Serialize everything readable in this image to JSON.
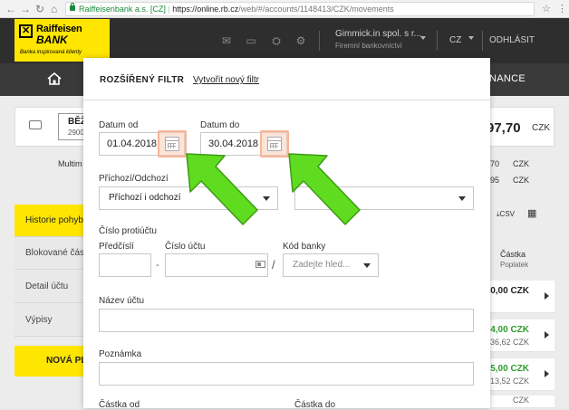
{
  "browser": {
    "secure_label": "Raiffeisenbank a.s. [CZ]",
    "url_host": "https://online.rb.cz",
    "url_path": "/web/#/accounts/1148413/CZK/movements"
  },
  "header": {
    "logo_line1": "Raiffeisen",
    "logo_line2": "BANK",
    "logo_tagline": "Banka inspirovaná klienty",
    "user_name": "Gimmick.in spol. s r...",
    "user_role": "Firemní bankovnictví",
    "currency": "CZ",
    "logout": "ODHLÁSIT"
  },
  "nav": {
    "finance_label": "NANCE"
  },
  "background": {
    "account_name": "BĚŽ",
    "account_number": "2900",
    "balance": "97,70",
    "balance_currency": "CZK",
    "multi_label": "Multim",
    "row1_value": "70",
    "row1_currency": "CZK",
    "row2_value": "95",
    "row2_currency": "CZK",
    "csv_label": "CSV",
    "column_title": "Částka",
    "column_sub": "Poplatek",
    "sidebar": [
      {
        "label": "Historie pohybů"
      },
      {
        "label": "Blokované část"
      },
      {
        "label": "Detail účtu"
      },
      {
        "label": "Výpisy"
      }
    ],
    "new_button": "NOVÁ PL",
    "rows": [
      {
        "value": "0,00 CZK",
        "sub": ""
      },
      {
        "value": "4,00 CZK",
        "sub": "36,62 CZK"
      },
      {
        "value": "5,00 CZK",
        "sub": "13,52 CZK"
      },
      {
        "value": "",
        "sub": "CZK"
      }
    ]
  },
  "modal": {
    "title": "ROZŠÍŘENÝ FILTR",
    "new_filter_link": "Vytvořit nový filtr",
    "date_from_label": "Datum od",
    "date_from_value": "01.04.2018",
    "date_to_label": "Datum do",
    "date_to_value": "30.04.2018",
    "direction_label": "Příchozí/Odchozí",
    "direction_value": "Příchozí i odchozí",
    "counter_account_label": "Číslo protiúčtu",
    "prefix_label": "Předčíslí",
    "account_number_label": "Číslo účtu",
    "bank_code_label": "Kód banky",
    "bank_code_placeholder": "Zadejte hled...",
    "separator_dash": "-",
    "separator_slash": "/",
    "account_name_label": "Název účtu",
    "note_label": "Poznámka",
    "amount_from_label": "Částka od",
    "amount_to_label": "Částka do"
  },
  "colors": {
    "brand_yellow": "#fee600",
    "header_dark": "#2e2e2e",
    "nav_dark": "#3a3a3a",
    "annotation_arrow": "#5fdc1f",
    "highlight": "#f6b59a",
    "positive_amount": "#2e9e2e"
  }
}
